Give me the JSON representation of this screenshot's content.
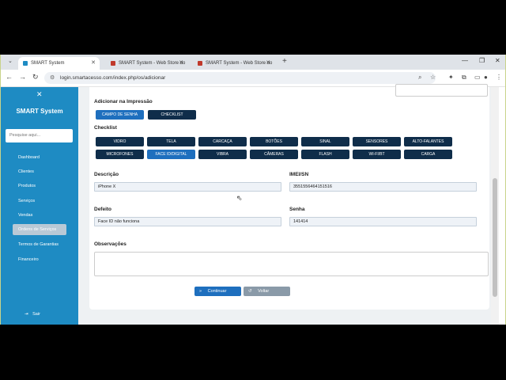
{
  "browser": {
    "tabs": [
      {
        "title": "SMART System",
        "active": true
      },
      {
        "title": "SMART System - Web Store do",
        "active": false
      },
      {
        "title": "SMART System - Web Store do",
        "active": false
      }
    ],
    "url": "login.smartacesso.com/index.php/os/adicionar"
  },
  "sidebar": {
    "title": "SMART System",
    "search_placeholder": "Pesquise aqui...",
    "items": [
      {
        "label": "Dashboard"
      },
      {
        "label": "Clientes"
      },
      {
        "label": "Produtos"
      },
      {
        "label": "Serviços"
      },
      {
        "label": "Vendas"
      },
      {
        "label": "Ordens de Serviços",
        "active": true
      },
      {
        "label": "Termos de Garantias"
      },
      {
        "label": "Financeiro"
      }
    ],
    "exit_label": "Sair"
  },
  "form": {
    "print_label": "Adicionar na Impressão",
    "print_buttons": [
      {
        "label": "CAMPO DE SENHA",
        "selected": true
      },
      {
        "label": "CHECKLIST",
        "selected": false
      }
    ],
    "checklist_label": "Checklist",
    "checklist_buttons": [
      {
        "label": "VIDRO",
        "selected": false
      },
      {
        "label": "TELA",
        "selected": false
      },
      {
        "label": "CARCAÇA",
        "selected": false
      },
      {
        "label": "BOTÕES",
        "selected": false
      },
      {
        "label": "SINAL",
        "selected": false
      },
      {
        "label": "SENSORES",
        "selected": false
      },
      {
        "label": "ALTO-FALANTES",
        "selected": false
      },
      {
        "label": "MICROFONES",
        "selected": false
      },
      {
        "label": "FACE ID/DIGITAL",
        "selected": true
      },
      {
        "label": "VIBRA",
        "selected": false
      },
      {
        "label": "CÂMERAS",
        "selected": false
      },
      {
        "label": "FLASH",
        "selected": false
      },
      {
        "label": "WI-FI/BT",
        "selected": false
      },
      {
        "label": "CARGA",
        "selected": false
      }
    ],
    "descricao_label": "Descrição",
    "descricao_value": "iPhone X",
    "imei_label": "IMEI/SN",
    "imei_value": "3551556464151516",
    "defeito_label": "Defeito",
    "defeito_value": "Face ID não funciona",
    "senha_label": "Senha",
    "senha_value": "141414",
    "observacoes_label": "Observações",
    "continue_label": "Continuar",
    "back_label": "Voltar"
  },
  "colors": {
    "sidebar": "#1e8bc3",
    "button_dark": "#0f2d4a",
    "button_selected": "#1e6fbe"
  }
}
